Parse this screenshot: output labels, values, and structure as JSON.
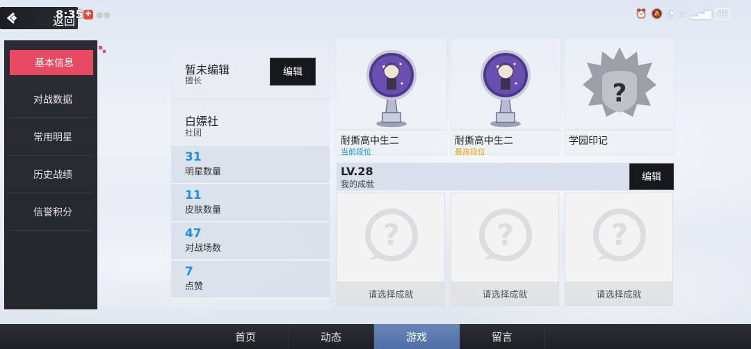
{
  "status_bar": {
    "time": "8:35",
    "back_label": "返回",
    "battery": "42",
    "network": "5G"
  },
  "nav": {
    "items": [
      {
        "label": "基本信息",
        "active": true
      },
      {
        "label": "对战数据",
        "active": false
      },
      {
        "label": "常用明星",
        "active": false
      },
      {
        "label": "历史战绩",
        "active": false
      },
      {
        "label": "信誉积分",
        "active": false
      }
    ]
  },
  "info": {
    "specialty_value": "暂未编辑",
    "specialty_label": "擅长",
    "edit_label": "编辑",
    "club_value": "白嫖社",
    "club_label": "社团",
    "stats": [
      {
        "value": "31",
        "label": "明星数量"
      },
      {
        "value": "11",
        "label": "皮肤数量"
      },
      {
        "value": "47",
        "label": "对战场数"
      },
      {
        "value": "7",
        "label": "点赞"
      }
    ]
  },
  "ranks": [
    {
      "title": "耐撕高中生二",
      "subtitle": "当前段位",
      "subtitle_color": "#1d8fe0"
    },
    {
      "title": "耐撕高中生二",
      "subtitle": "最高段位",
      "subtitle_color": "#e8a323"
    },
    {
      "title": "学园印记",
      "subtitle": "",
      "subtitle_color": "#888888"
    }
  ],
  "achievements": {
    "level": "LV.28",
    "label": "我的成就",
    "edit_label": "编辑",
    "slots": [
      {
        "label": "请选择成就"
      },
      {
        "label": "请选择成就"
      },
      {
        "label": "请选择成就"
      }
    ]
  },
  "tabs": [
    {
      "label": "首页",
      "active": false
    },
    {
      "label": "动态",
      "active": false
    },
    {
      "label": "游戏",
      "active": true
    },
    {
      "label": "留言",
      "active": false
    }
  ],
  "colors": {
    "accent": "#e84a63",
    "stat_blue": "#1d8fe0",
    "tab_active": "#5775aa"
  }
}
